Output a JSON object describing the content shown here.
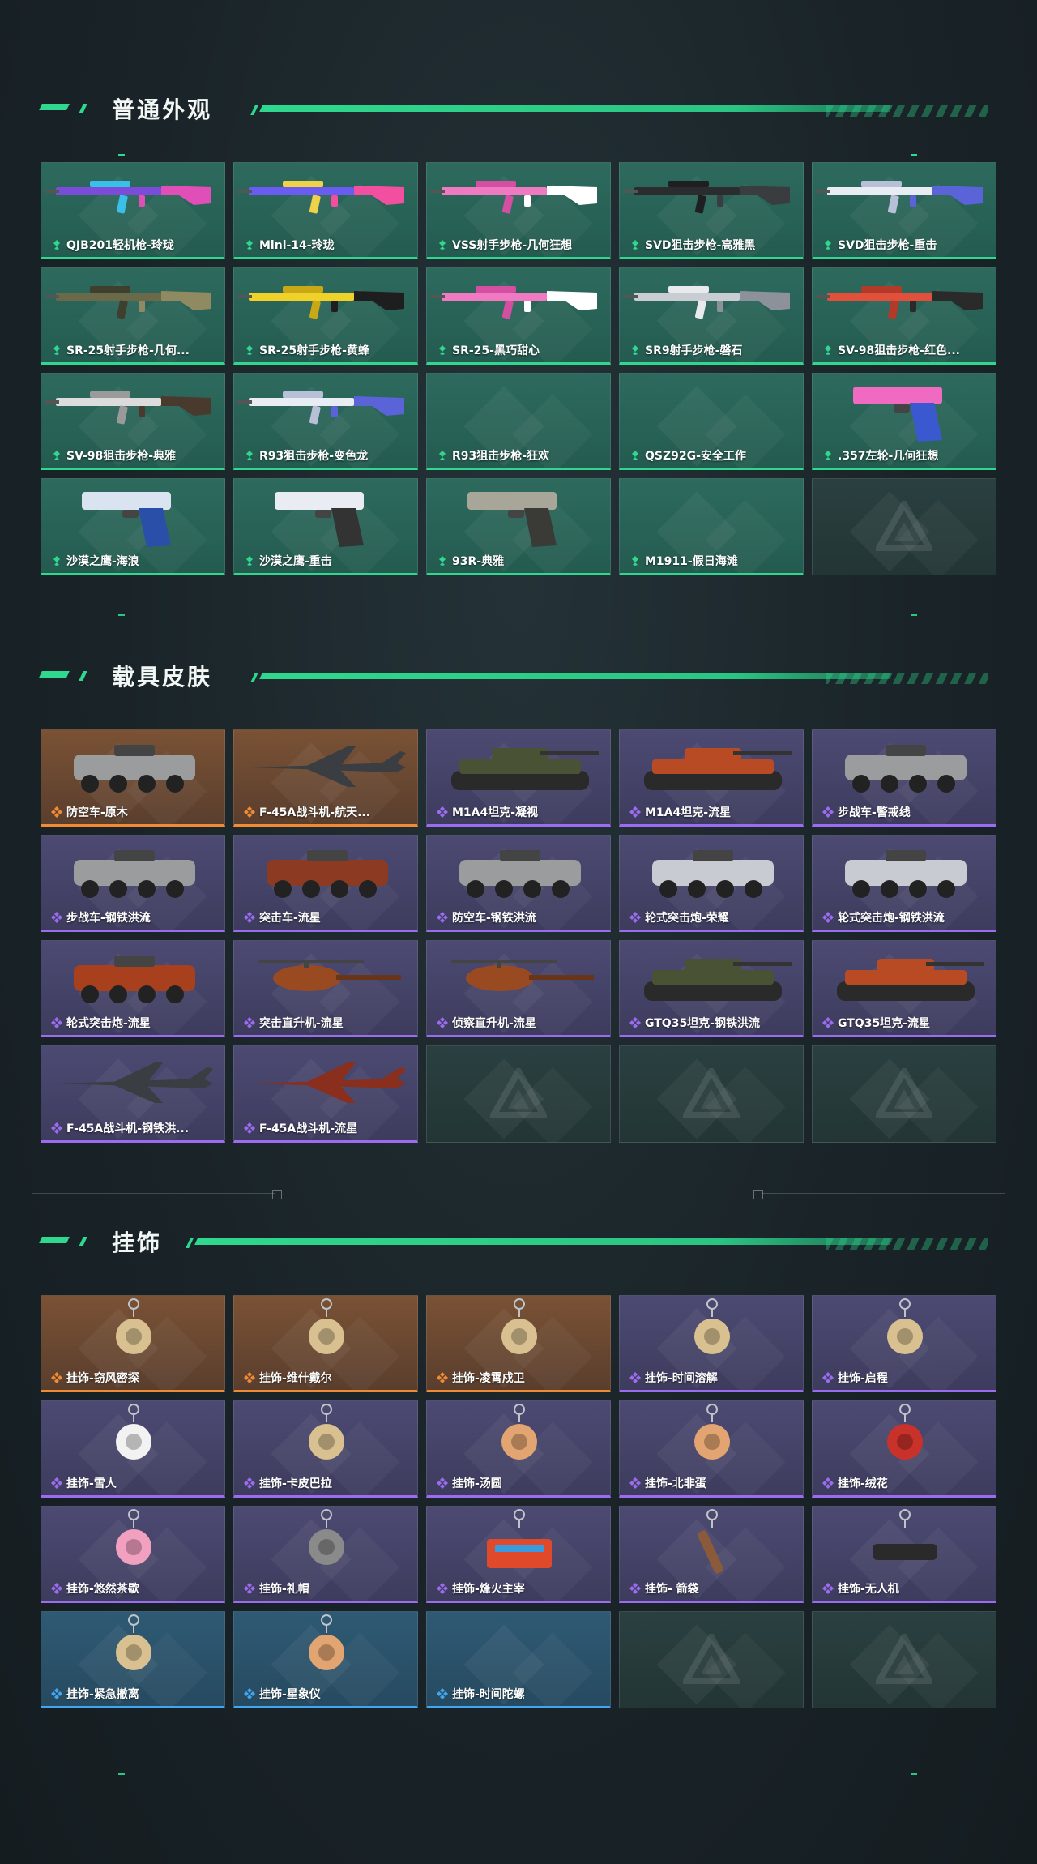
{
  "sections": [
    {
      "title": "普通外观",
      "items": [
        {
          "label": "QJB201轻机枪-玲珑",
          "rarity": "teal",
          "art": "rifle-purple-icon"
        },
        {
          "label": "Mini-14-玲珑",
          "rarity": "teal",
          "art": "rifle-rainbow-icon"
        },
        {
          "label": "VSS射手步枪-几何狂想",
          "rarity": "teal",
          "art": "rifle-pink-icon"
        },
        {
          "label": "SVD狙击步枪-高雅黑",
          "rarity": "teal",
          "art": "sniper-black-icon"
        },
        {
          "label": "SVD狙击步枪-重击",
          "rarity": "teal",
          "art": "sniper-white-icon"
        },
        {
          "label": "SR-25射手步枪-几何...",
          "rarity": "teal",
          "art": "rifle-camo-icon"
        },
        {
          "label": "SR-25射手步枪-黄蜂",
          "rarity": "teal",
          "art": "rifle-yellow-icon"
        },
        {
          "label": "SR-25-黑巧甜心",
          "rarity": "teal",
          "art": "rifle-pink-icon"
        },
        {
          "label": "SR9射手步枪-磐石",
          "rarity": "teal",
          "art": "rifle-grey-icon"
        },
        {
          "label": "SV-98狙击步枪-红色...",
          "rarity": "teal",
          "art": "sniper-red-icon"
        },
        {
          "label": "SV-98狙击步枪-典雅",
          "rarity": "teal",
          "art": "sniper-marble-icon"
        },
        {
          "label": "R93狙击步枪-变色龙",
          "rarity": "teal",
          "art": "sniper-white-icon"
        },
        {
          "label": "R93狙击步枪-狂欢",
          "rarity": "teal",
          "art": ""
        },
        {
          "label": "QSZ92G-安全工作",
          "rarity": "teal",
          "art": ""
        },
        {
          "label": ".357左轮-几何狂想",
          "rarity": "teal",
          "art": "revolver-icon"
        },
        {
          "label": "沙漠之鹰-海浪",
          "rarity": "teal",
          "art": "pistol-blue-icon"
        },
        {
          "label": "沙漠之鹰-重击",
          "rarity": "teal",
          "art": "pistol-white-icon"
        },
        {
          "label": "93R-典雅",
          "rarity": "teal",
          "art": "pistol-grey-icon"
        },
        {
          "label": "M1911-假日海滩",
          "rarity": "teal",
          "art": ""
        },
        {
          "label": "",
          "rarity": "empty",
          "art": ""
        }
      ]
    },
    {
      "title": "载具皮肤",
      "items": [
        {
          "label": "防空车-原木",
          "rarity": "orange",
          "art": "apc-icon"
        },
        {
          "label": "F-45A战斗机-航天...",
          "rarity": "orange",
          "art": "jet-icon"
        },
        {
          "label": "M1A4坦克-凝视",
          "rarity": "purple",
          "art": "tank-icon"
        },
        {
          "label": "M1A4坦克-流星",
          "rarity": "purple",
          "art": "tank-red-icon"
        },
        {
          "label": "步战车-警戒线",
          "rarity": "purple",
          "art": "apc-icon"
        },
        {
          "label": "步战车-钢铁洪流",
          "rarity": "purple",
          "art": "apc-icon"
        },
        {
          "label": "突击车-流星",
          "rarity": "purple",
          "art": "truck-red-icon"
        },
        {
          "label": "防空车-钢铁洪流",
          "rarity": "purple",
          "art": "apc-icon"
        },
        {
          "label": "轮式突击炮-荣耀",
          "rarity": "purple",
          "art": "buggy-icon"
        },
        {
          "label": "轮式突击炮-钢铁洪流",
          "rarity": "purple",
          "art": "buggy-icon"
        },
        {
          "label": "轮式突击炮-流星",
          "rarity": "purple",
          "art": "buggy-red-icon"
        },
        {
          "label": "突击直升机-流星",
          "rarity": "purple",
          "art": "helicopter-icon"
        },
        {
          "label": "侦察直升机-流星",
          "rarity": "purple",
          "art": "helicopter-small-icon"
        },
        {
          "label": "GTQ35坦克-钢铁洪流",
          "rarity": "purple",
          "art": "tank-icon"
        },
        {
          "label": "GTQ35坦克-流星",
          "rarity": "purple",
          "art": "tank-red-icon"
        },
        {
          "label": "F-45A战斗机-钢铁洪...",
          "rarity": "purple",
          "art": "jet-icon"
        },
        {
          "label": "F-45A战斗机-流星",
          "rarity": "purple",
          "art": "jet-red-icon"
        },
        {
          "label": "",
          "rarity": "empty",
          "art": ""
        },
        {
          "label": "",
          "rarity": "empty",
          "art": ""
        },
        {
          "label": "",
          "rarity": "empty",
          "art": ""
        }
      ]
    },
    {
      "title": "挂饰",
      "items": [
        {
          "label": "挂饰-窃风密探",
          "rarity": "orange",
          "art": "charm-icon"
        },
        {
          "label": "挂饰-维什戴尔",
          "rarity": "orange",
          "art": "charm-icon"
        },
        {
          "label": "挂饰-凌霄戍卫",
          "rarity": "orange",
          "art": "charm-icon"
        },
        {
          "label": "挂饰-时间溶解",
          "rarity": "purple",
          "art": "charm-icon"
        },
        {
          "label": "挂饰-启程",
          "rarity": "purple",
          "art": "charm-icon"
        },
        {
          "label": "挂饰-雪人",
          "rarity": "purple",
          "art": "charm-snowman-icon"
        },
        {
          "label": "挂饰-卡皮巴拉",
          "rarity": "purple",
          "art": "charm-icon"
        },
        {
          "label": "挂饰-汤圆",
          "rarity": "purple",
          "art": "charm-round-icon"
        },
        {
          "label": "挂饰-北非蛋",
          "rarity": "purple",
          "art": "charm-round-icon"
        },
        {
          "label": "挂饰-绒花",
          "rarity": "purple",
          "art": "charm-flower-icon"
        },
        {
          "label": "挂饰-悠然茶歇",
          "rarity": "purple",
          "art": "charm-cake-icon"
        },
        {
          "label": "挂饰-礼帽",
          "rarity": "purple",
          "art": "charm-hat-icon"
        },
        {
          "label": "挂饰-烽火主宰",
          "rarity": "purple",
          "art": "charm-banner-icon"
        },
        {
          "label": "挂饰- 箭袋",
          "rarity": "purple",
          "art": "charm-quiver-icon"
        },
        {
          "label": "挂饰-无人机",
          "rarity": "purple",
          "art": "charm-drone-icon"
        },
        {
          "label": "挂饰-紧急撤离",
          "rarity": "blue",
          "art": "charm-icon"
        },
        {
          "label": "挂饰-星象仪",
          "rarity": "blue",
          "art": "charm-round-icon"
        },
        {
          "label": "挂饰-时间陀螺",
          "rarity": "blue",
          "art": ""
        },
        {
          "label": "",
          "rarity": "empty",
          "art": ""
        },
        {
          "label": "",
          "rarity": "empty",
          "art": ""
        }
      ]
    }
  ],
  "colors": {
    "accent": "#2fd88e",
    "teal": "#2fd88e",
    "purple": "#9b6cf0",
    "orange": "#f08a34",
    "blue": "#42a5ef"
  }
}
